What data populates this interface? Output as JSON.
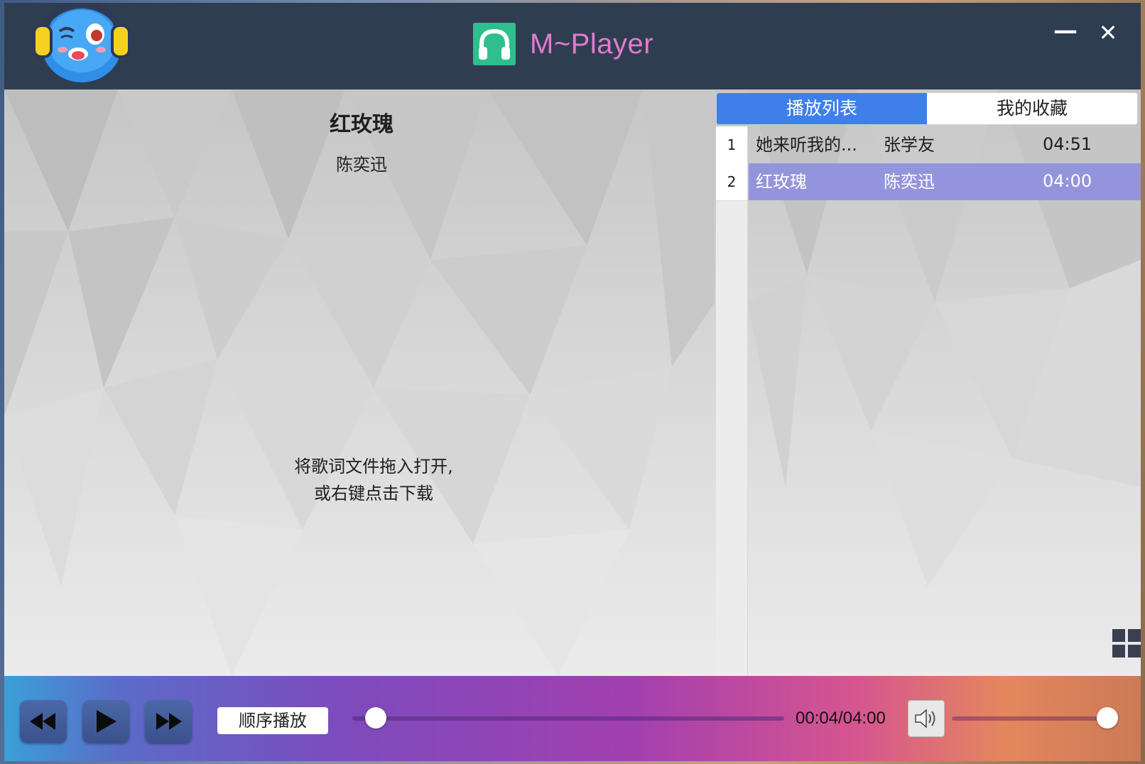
{
  "app": {
    "title": "M~Player"
  },
  "window_controls": {
    "minimize": "—",
    "close": "✕"
  },
  "now_playing": {
    "title": "红玫瑰",
    "artist": "陈奕迅",
    "lyrics_hint_line1": "将歌词文件拖入打开,",
    "lyrics_hint_line2": "或右键点击下载"
  },
  "tabs": [
    {
      "label": "播放列表",
      "active": true
    },
    {
      "label": "我的收藏",
      "active": false
    }
  ],
  "playlist": [
    {
      "num": "1",
      "name": "她来听我的...",
      "artist": "张学友",
      "duration": "04:51",
      "selected": false
    },
    {
      "num": "2",
      "name": "红玫瑰",
      "artist": "陈奕迅",
      "duration": "04:00",
      "selected": true
    }
  ],
  "controls": {
    "mode_label": "顺序播放",
    "time_display": "00:04/04:00",
    "progress_fraction": 0.017,
    "volume_fraction": 1.0
  },
  "icons": {
    "prev": "rewind-icon",
    "play": "play-icon",
    "next": "fast-forward-icon",
    "volume": "speaker-icon",
    "grid": "grid-icon"
  },
  "colors": {
    "titlebar": "#2f3d50",
    "app_title": "#e27ad0",
    "logo": "#2fbf8f",
    "tab_active": "#3f7fea",
    "selected_row": "#9494dc"
  }
}
